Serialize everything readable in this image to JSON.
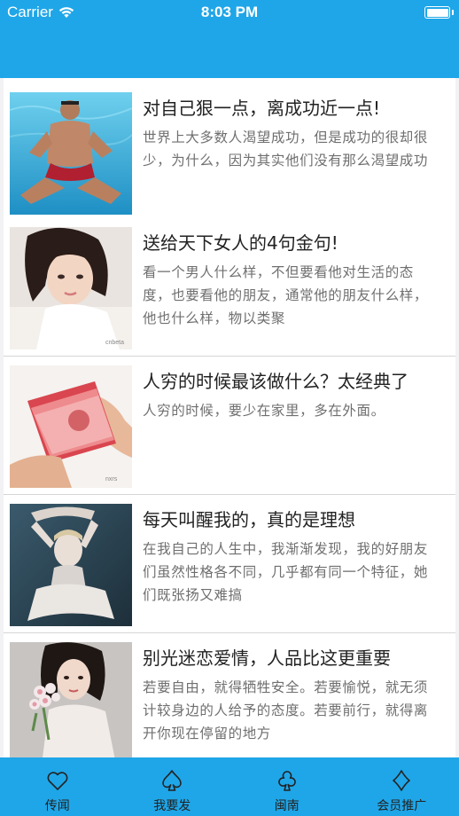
{
  "status_bar": {
    "carrier": "Carrier",
    "time": "8:03 PM",
    "battery_level": 1.0
  },
  "articles": [
    {
      "title": "对自己狠一点，离成功近一点!",
      "desc": "世界上大多数人渴望成功，但是成功的很却很少，为什么，因为其实他们没有那么渴望成功",
      "image": "underwater-man-photo"
    },
    {
      "title": "送给天下女人的4句金句!",
      "desc": "看一个男人什么样，不但要看他对生活的态度，也要看他的朋友，通常他的朋友什么样，他也什么样，物以类聚",
      "image": "woman-portrait-photo"
    },
    {
      "title": "人穷的时候最该做什么？太经典了",
      "desc": "人穷的时候，要少在家里，多在外面。",
      "image": "money-banknotes-photo"
    },
    {
      "title": "每天叫醒我的，真的是理想",
      "desc": "在我自己的人生中，我渐渐发现，我的好朋友们虽然性格各不同，几乎都有同一个特征，她们既张扬又难搞",
      "image": "dancer-photo"
    },
    {
      "title": "别光迷恋爱情，人品比这更重要",
      "desc": "若要自由，就得牺牲安全。若要愉悦，就无须计较身边的人给予的态度。若要前行，就得离开你现在停留的地方",
      "image": "woman-with-flowers-photo"
    }
  ],
  "tabs": [
    {
      "label": "传闻",
      "icon": "heart-icon"
    },
    {
      "label": "我要发",
      "icon": "spade-icon"
    },
    {
      "label": "闽南",
      "icon": "club-icon"
    },
    {
      "label": "会员推广",
      "icon": "diamond-icon"
    }
  ],
  "colors": {
    "accent": "#1fa6e8",
    "title": "#222222",
    "desc": "#6f6f6f"
  }
}
